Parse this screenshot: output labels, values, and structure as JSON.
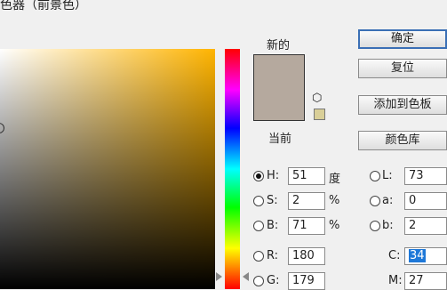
{
  "title": "色器（前景色）",
  "new_label": "新的",
  "current_label": "当前",
  "colors": {
    "new": "#b5a99e",
    "websafe": "#d9cf98",
    "hue": "#ffb400"
  },
  "icons": {
    "gamut_cube": "cube-icon"
  },
  "buttons": {
    "ok": "确定",
    "reset": "复位",
    "add_swatch": "添加到色板",
    "libraries": "颜色库"
  },
  "hsb": {
    "h": {
      "label": "H:",
      "value": "51",
      "unit": "度"
    },
    "s": {
      "label": "S:",
      "value": "2",
      "unit": "%"
    },
    "b": {
      "label": "B:",
      "value": "71",
      "unit": "%"
    }
  },
  "rgb": {
    "r": {
      "label": "R:",
      "value": "180"
    },
    "g": {
      "label": "G:",
      "value": "179"
    }
  },
  "lab": {
    "l": {
      "label": "L:",
      "value": "73"
    },
    "a": {
      "label": "a:",
      "value": "0"
    },
    "b": {
      "label": "b:",
      "value": "2"
    }
  },
  "cmyk": {
    "c": {
      "label": "C:",
      "value": "34"
    },
    "m": {
      "label": "M:",
      "value": "27"
    }
  }
}
